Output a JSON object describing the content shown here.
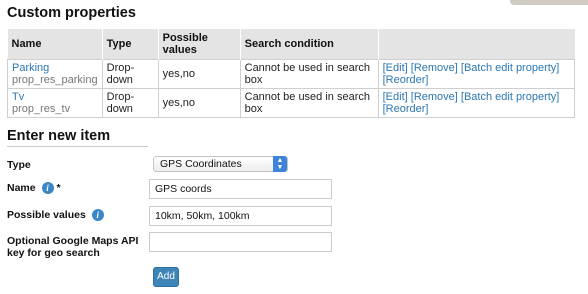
{
  "sections": {
    "custom_properties": "Custom properties",
    "enter_new_item": "Enter new item"
  },
  "table": {
    "headers": [
      "Name",
      "Type",
      "Possible values",
      "Search condition"
    ],
    "rows": [
      {
        "name": "Parking",
        "key": "prop_res_parking",
        "type": "Drop-down",
        "values": "yes,no",
        "condition": "Cannot be used in search box",
        "actions": [
          "[Edit]",
          "[Remove]",
          "[Batch edit property]",
          "[Reorder]"
        ]
      },
      {
        "name": "Tv",
        "key": "prop_res_tv",
        "type": "Drop-down",
        "values": "yes,no",
        "condition": "Cannot be used in search box",
        "actions": [
          "[Edit]",
          "[Remove]",
          "[Batch edit property]",
          "[Reorder]"
        ]
      }
    ]
  },
  "form": {
    "type_label": "Type",
    "type_value": "GPS Coordinates",
    "name_label": "Name",
    "required_mark": "*",
    "name_value": "GPS coords",
    "values_label": "Possible values",
    "values_value": "10km, 50km, 100km",
    "api_label_line1": "Optional Google Maps API",
    "api_label_line2": "key for geo search",
    "api_value": "",
    "add_label": "Add"
  },
  "icons": {
    "info": "info-icon",
    "select_arrows": "chevron-updown-icon"
  },
  "colors": {
    "link": "#2a77b4",
    "button": "#3d84b7",
    "header_bg": "#e4e4e4"
  }
}
